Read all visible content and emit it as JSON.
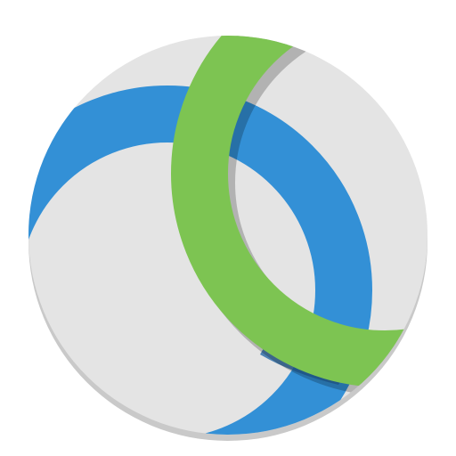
{
  "icon": {
    "name": "cisco-webex-teams-app-icon",
    "colors": {
      "disc": "#e4e4e4",
      "disc_shadow": "#c9c9c9",
      "blue_ring": "#3390d6",
      "blue_ring_dark": "#2769a6",
      "green_ring": "#7dc452",
      "ring_shadow": "#9a9a9a",
      "highlight": "#ffffff"
    }
  }
}
